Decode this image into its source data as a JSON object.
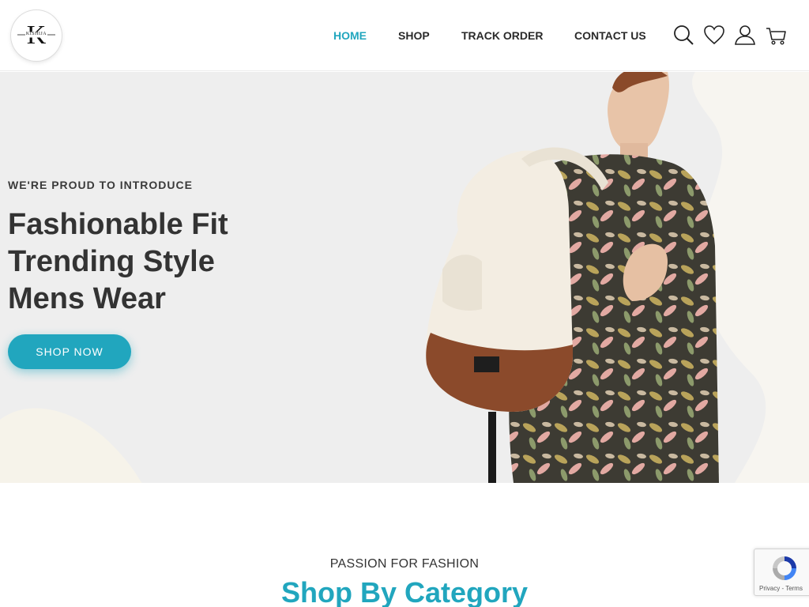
{
  "brand": {
    "logo_text": "KISHIJA",
    "logo_letter": "K"
  },
  "nav": {
    "items": [
      {
        "label": "HOME",
        "active": true
      },
      {
        "label": "SHOP",
        "active": false
      },
      {
        "label": "TRACK ORDER",
        "active": false
      },
      {
        "label": "CONTACT US",
        "active": false
      }
    ]
  },
  "header_icons": [
    "search-icon",
    "heart-icon",
    "user-icon",
    "cart-icon"
  ],
  "hero": {
    "subtitle": "WE'RE PROUD TO INTRODUCE",
    "title_lines": [
      "Fashionable Fit",
      "Trending Style",
      "Mens Wear"
    ],
    "cta_label": "SHOP NOW"
  },
  "category_section": {
    "kicker": "PASSION FOR FASHION",
    "title": "Shop By Category"
  },
  "recaptcha": {
    "links": "Privacy - Terms"
  },
  "colors": {
    "accent": "#21a6be",
    "hero_bg": "#eeeeee",
    "text_dark": "#333333"
  }
}
